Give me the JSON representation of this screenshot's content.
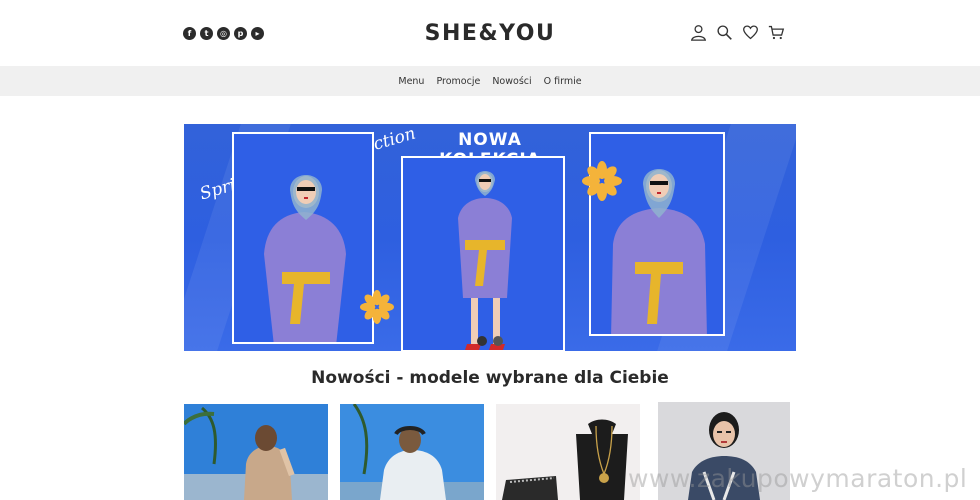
{
  "brand": {
    "logo_text": "SHE&YOU"
  },
  "header": {
    "social_icons": [
      "facebook-icon",
      "twitter-icon",
      "instagram-icon",
      "pinterest-icon",
      "youtube-icon"
    ],
    "tool_icons": [
      "user-icon",
      "search-icon",
      "heart-icon",
      "cart-icon"
    ]
  },
  "nav": {
    "items": [
      {
        "label": "Menu"
      },
      {
        "label": "Promocje"
      },
      {
        "label": "Nowości"
      },
      {
        "label": "O firmie"
      }
    ]
  },
  "hero": {
    "title": "NOWA KOLEKCJA",
    "script_text": "Spring SummerCollection",
    "slide_count": 2,
    "active_slide": 1,
    "colors": {
      "background": "#2e5fe0",
      "coat": "#8b7fd6",
      "belt": "#e7b52b",
      "flower": "#f4b33a"
    }
  },
  "section": {
    "title": "Nowości - modele wybrane dla Ciebie"
  },
  "products": [
    {
      "name": "product-1",
      "colors": {
        "top": "#2f80d8",
        "bottom": "#c8a88a"
      }
    },
    {
      "name": "product-2",
      "colors": {
        "top": "#3b8de0",
        "bottom": "#e9eef2"
      }
    },
    {
      "name": "product-3",
      "colors": {
        "top": "#f2efef",
        "bottom": "#eae6e4"
      }
    },
    {
      "name": "product-4",
      "colors": {
        "top": "#d9d9dc",
        "bottom": "#3a4a66"
      }
    }
  ],
  "watermark": {
    "text": "www.zakupowymaraton.pl"
  }
}
